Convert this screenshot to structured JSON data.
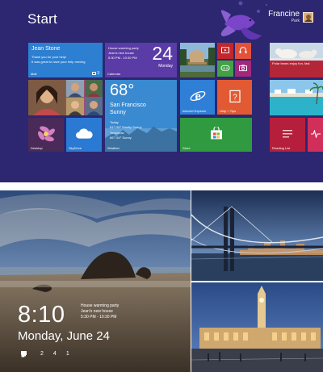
{
  "start": {
    "title": "Start",
    "user": {
      "name": "Francine",
      "sub": "Park"
    },
    "mail": {
      "sender": "Jean Stone",
      "line1": "Thank you for your help!",
      "line2": "It was great to have your help moving",
      "label": "Mail",
      "count": "3"
    },
    "calendar": {
      "event": "House warming party",
      "location": "Jean's new house",
      "time": "5:30 PM - 10:30 PM",
      "day": "24",
      "weekday": "Monday",
      "label": "Calendar"
    },
    "weather": {
      "temp": "68°",
      "city": "San Francisco",
      "condition": "Sunny",
      "today_label": "Today",
      "today_detail": "61°/ 50° Mostly Sunny",
      "tomorrow_label": "Tomorrow",
      "tomorrow_detail": "66°/ 54° Sunny",
      "label": "Weather"
    },
    "photo_tile_label": "Desktop",
    "skydrive_label": "SkyDrive",
    "ie_label": "Internet Explorer",
    "help_label": "Help + Tips",
    "store_label": "Store",
    "news": {
      "headline": "Polar bears enjoy fun, fast"
    },
    "reading_label": "Reading List",
    "colors": {
      "background": "#2c2770",
      "mail": "#2d7fd1",
      "calendar": "#5b3ba6",
      "weather": "#3a8ad1",
      "store": "#2f9a3f",
      "help": "#e25a33",
      "news": "#b22638"
    }
  },
  "lock": {
    "time": "8:10",
    "date": "Monday, June 24",
    "event_title": "House warming party",
    "event_place": "Jean's new house",
    "event_time": "5:30 PM - 10:30 PM",
    "status": [
      {
        "icon": "wifi-icon",
        "value": ""
      },
      {
        "icon": "battery-icon",
        "value": ""
      },
      {
        "icon": "mail-icon",
        "value": "2"
      },
      {
        "icon": "messaging-icon",
        "value": "4"
      },
      {
        "icon": "alarm-icon",
        "value": "1"
      }
    ]
  }
}
